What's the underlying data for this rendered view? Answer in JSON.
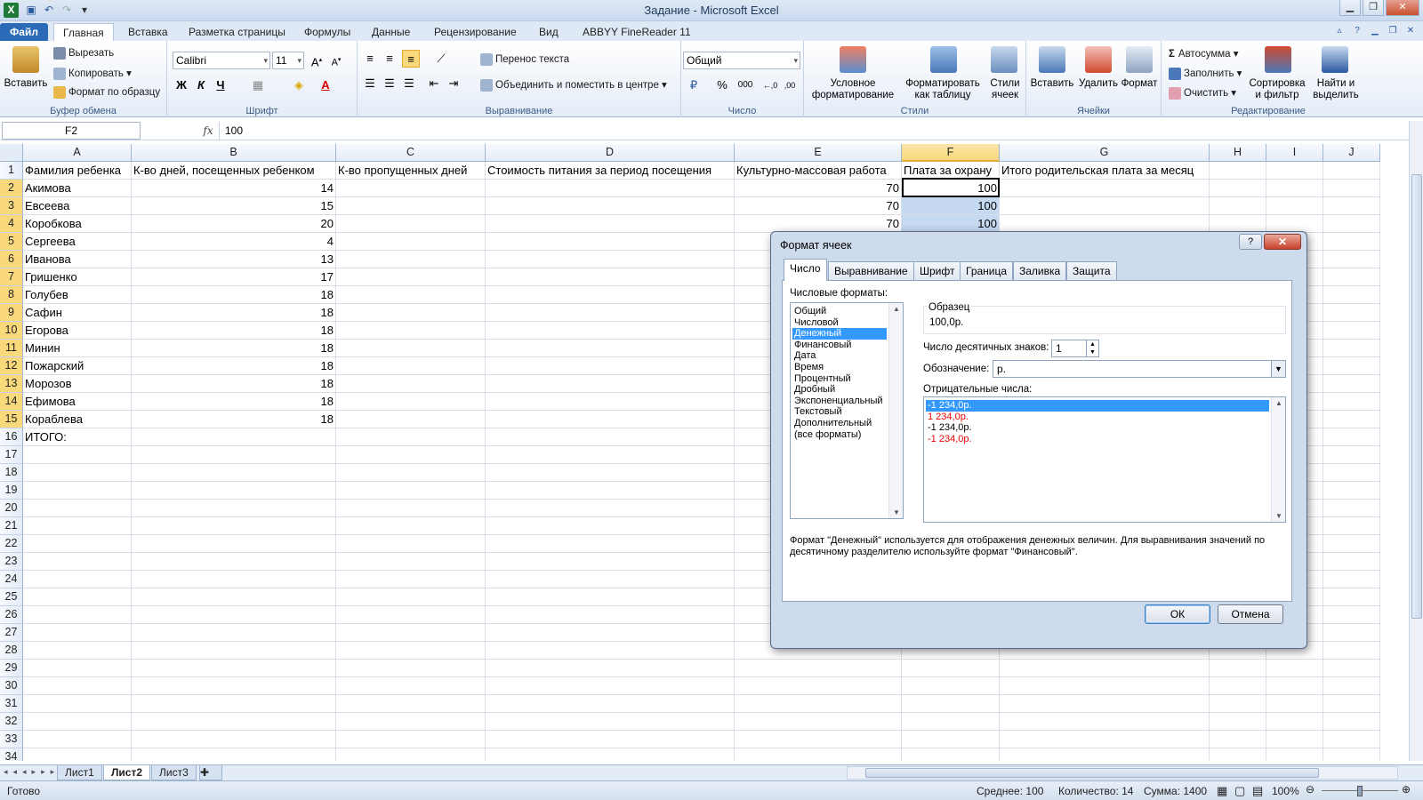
{
  "app": {
    "title": "Задание  -  Microsoft Excel",
    "logo": "X"
  },
  "ribbon_tabs": [
    {
      "label": "Файл"
    },
    {
      "label": "Главная"
    },
    {
      "label": "Вставка"
    },
    {
      "label": "Разметка страницы"
    },
    {
      "label": "Формулы"
    },
    {
      "label": "Данные"
    },
    {
      "label": "Рецензирование"
    },
    {
      "label": "Вид"
    },
    {
      "label": "ABBYY FineReader 11"
    }
  ],
  "clipboard": {
    "group_label": "Буфер обмена",
    "paste": "Вставить",
    "cut": "Вырезать",
    "copy": "Копировать",
    "format_painter": "Формат по образцу"
  },
  "font": {
    "group_label": "Шрифт",
    "name": "Calibri",
    "size": "11",
    "bold": "Ж",
    "italic": "К",
    "underline": "Ч"
  },
  "alignment": {
    "group_label": "Выравнивание",
    "wrap_text": "Перенос текста",
    "merge_center": "Объединить и поместить в центре"
  },
  "number": {
    "group_label": "Число",
    "format": "Общий",
    "percent": "%",
    "thousands": "000"
  },
  "styles": {
    "group_label": "Стили",
    "conditional": "Условное\nформатирование",
    "as_table": "Форматировать\nкак таблицу",
    "cell_styles": "Стили\nячеек"
  },
  "cells_group": {
    "group_label": "Ячейки",
    "insert": "Вставить",
    "delete": "Удалить",
    "format": "Формат"
  },
  "editing": {
    "group_label": "Редактирование",
    "autosum": "Автосумма",
    "fill": "Заполнить",
    "clear": "Очистить",
    "sort": "Сортировка\nи фильтр",
    "find": "Найти и\nвыделить"
  },
  "formula_bar": {
    "name_box": "F2",
    "fx": "fx",
    "value": "100"
  },
  "columns": [
    "A",
    "B",
    "C",
    "D",
    "E",
    "F",
    "G",
    "H",
    "I",
    "J"
  ],
  "header_row": [
    "Фамилия ребенка",
    "К-во дней, посещенных ребенком",
    "К-во пропущенных дней",
    "Стоимость питания за период посещения",
    "Культурно-массовая работа",
    "Плата за охрану",
    "Итого родительская плата за месяц"
  ],
  "rows": [
    {
      "name": "Акимова",
      "days": "14",
      "culture": "70",
      "guard": "100"
    },
    {
      "name": "Евсеева",
      "days": "15",
      "culture": "70",
      "guard": "100"
    },
    {
      "name": "Коробкова",
      "days": "20",
      "culture": "70",
      "guard": "100"
    },
    {
      "name": "Сергеева",
      "days": "4",
      "culture": "",
      "guard": ""
    },
    {
      "name": "Иванова",
      "days": "13",
      "culture": "",
      "guard": ""
    },
    {
      "name": "Гришенко",
      "days": "17",
      "culture": "",
      "guard": ""
    },
    {
      "name": "Голубев",
      "days": "18",
      "culture": "",
      "guard": ""
    },
    {
      "name": "Сафин",
      "days": "18",
      "culture": "",
      "guard": ""
    },
    {
      "name": "Егорова",
      "days": "18",
      "culture": "",
      "guard": ""
    },
    {
      "name": "Минин",
      "days": "18",
      "culture": "",
      "guard": ""
    },
    {
      "name": "Пожарский",
      "days": "18",
      "culture": "",
      "guard": ""
    },
    {
      "name": "Морозов",
      "days": "18",
      "culture": "",
      "guard": ""
    },
    {
      "name": "Ефимова",
      "days": "18",
      "culture": "",
      "guard": ""
    },
    {
      "name": "Кораблева",
      "days": "18",
      "culture": "",
      "guard": ""
    },
    {
      "name": "ИТОГО:",
      "days": "",
      "culture": "",
      "guard": ""
    }
  ],
  "row_numbers": [
    "1",
    "2",
    "3",
    "4",
    "5",
    "6",
    "7",
    "8",
    "9",
    "10",
    "11",
    "12",
    "13",
    "14",
    "15",
    "16",
    "17",
    "18",
    "19",
    "20",
    "21",
    "22",
    "23",
    "24",
    "25",
    "26",
    "27",
    "28",
    "29",
    "30",
    "31",
    "32",
    "33",
    "34"
  ],
  "sheet_tabs": [
    "Лист1",
    "Лист2",
    "Лист3"
  ],
  "status": {
    "ready": "Готово",
    "average": "Среднее: 100",
    "count": "Количество: 14",
    "sum": "Сумма: 1400",
    "zoom": "100%"
  },
  "dialog": {
    "title": "Формат ячеек",
    "help": "?",
    "close": "✕",
    "tabs": [
      "Число",
      "Выравнивание",
      "Шрифт",
      "Граница",
      "Заливка",
      "Защита"
    ],
    "formats_label": "Числовые форматы:",
    "formats": [
      "Общий",
      "Числовой",
      "Денежный",
      "Финансовый",
      "Дата",
      "Время",
      "Процентный",
      "Дробный",
      "Экспоненциальный",
      "Текстовый",
      "Дополнительный",
      "(все форматы)"
    ],
    "sample_label": "Образец",
    "sample_value": "100,0р.",
    "decimals_label": "Число десятичных знаков:",
    "decimals_value": "1",
    "symbol_label": "Обозначение:",
    "symbol_value": "р.",
    "negative_label": "Отрицательные числа:",
    "negatives": [
      "-1 234,0р.",
      "1 234,0р.",
      "-1 234,0р.",
      "-1 234,0р."
    ],
    "description": "Формат \"Денежный\" используется для отображения денежных величин. Для выравнивания значений по десятичному разделителю используйте формат \"Финансовый\".",
    "ok": "ОК",
    "cancel": "Отмена"
  }
}
